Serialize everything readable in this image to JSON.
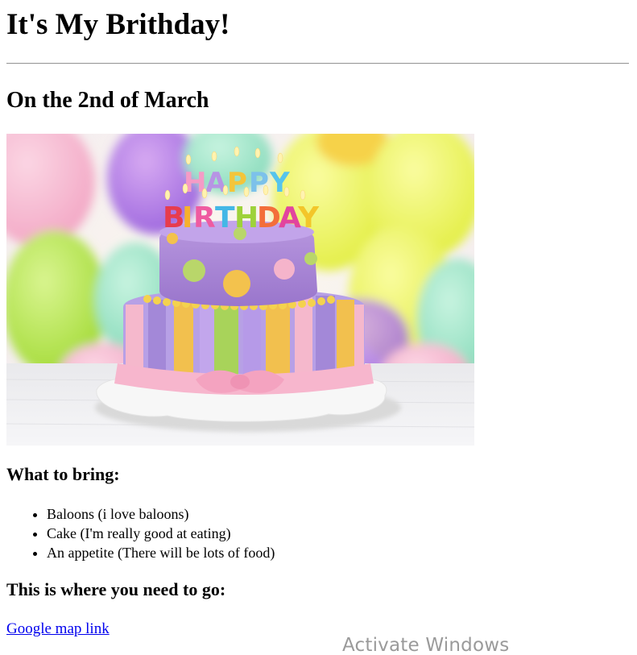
{
  "page": {
    "heading": "It's My Brithday!",
    "date_heading": "On the 2nd of March"
  },
  "photo": {
    "subject": "birthday-cake-image",
    "candle_text_top": "HAPPY",
    "candle_text_bottom": "BIRTHDAY"
  },
  "bring": {
    "heading": "What to bring:",
    "items": [
      "Baloons (i love baloons)",
      "Cake (I'm really good at eating)",
      "An appetite (There will be lots of food)"
    ]
  },
  "directions": {
    "heading": "This is where you need to go:",
    "link_text": "Google map link"
  },
  "os_overlay": {
    "watermark": "Activate Windows"
  },
  "colors": {
    "link": "#0000ee",
    "text": "#000000",
    "background": "#ffffff"
  }
}
